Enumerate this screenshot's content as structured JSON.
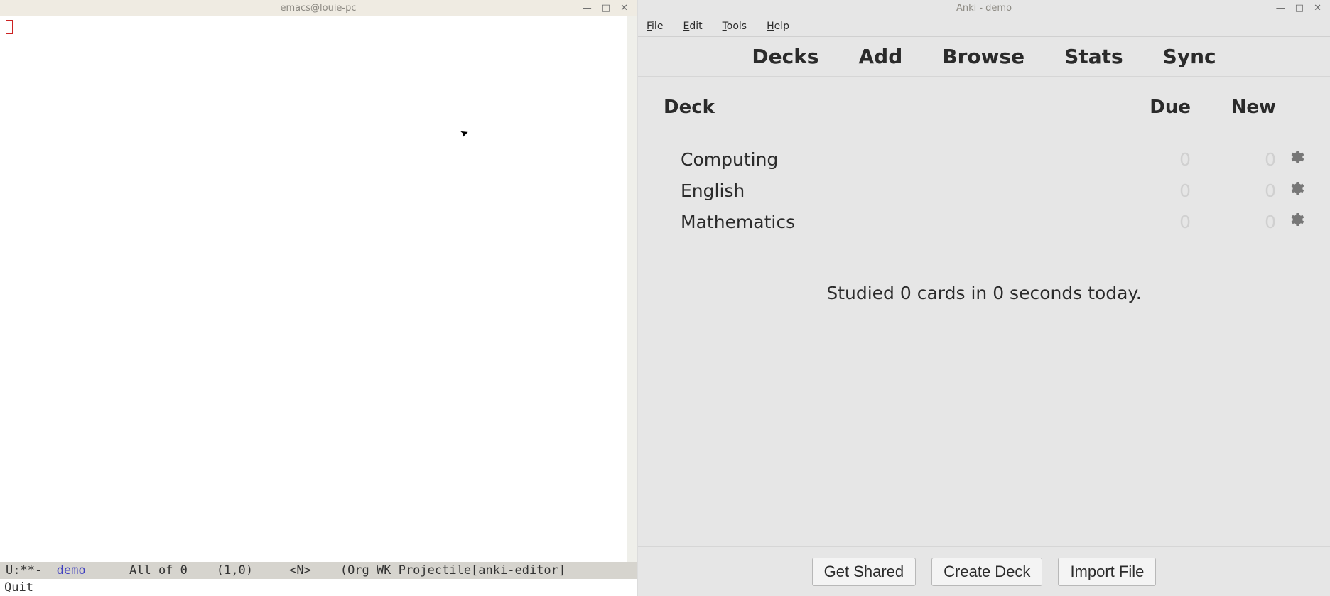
{
  "emacs": {
    "title": "emacs@louie-pc",
    "modeline": {
      "left": "U:**-  ",
      "buffer": "demo",
      "mid": "      All of 0    (1,0)     <N>    (Org WK Projectile[anki-editor]"
    },
    "echo": "Quit"
  },
  "anki": {
    "title": "Anki - demo",
    "menu": {
      "file": "File",
      "edit": "Edit",
      "tools": "Tools",
      "help": "Help"
    },
    "tabs": {
      "decks": "Decks",
      "add": "Add",
      "browse": "Browse",
      "stats": "Stats",
      "sync": "Sync"
    },
    "columns": {
      "deck": "Deck",
      "due": "Due",
      "new": "New"
    },
    "decks": [
      {
        "name": "Computing",
        "due": "0",
        "new": "0"
      },
      {
        "name": "English",
        "due": "0",
        "new": "0"
      },
      {
        "name": "Mathematics",
        "due": "0",
        "new": "0"
      }
    ],
    "status": "Studied 0 cards in 0 seconds today.",
    "footer": {
      "shared": "Get Shared",
      "create": "Create Deck",
      "import": "Import File"
    }
  }
}
